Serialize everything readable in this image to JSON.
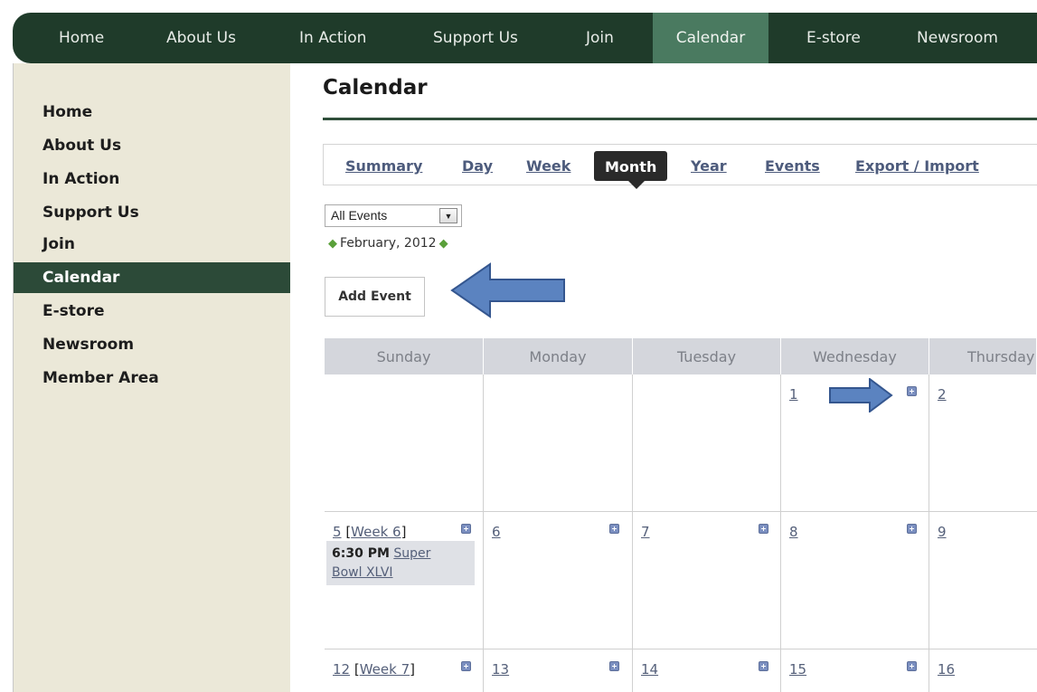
{
  "topnav": {
    "items": [
      {
        "label": "Home"
      },
      {
        "label": "About Us"
      },
      {
        "label": "In Action"
      },
      {
        "label": "Support Us"
      },
      {
        "label": "Join"
      },
      {
        "label": "Calendar",
        "active": true
      },
      {
        "label": "E-store"
      },
      {
        "label": "Newsroom"
      }
    ]
  },
  "sidebar": {
    "items": [
      {
        "label": "Home"
      },
      {
        "label": "About Us"
      },
      {
        "label": "In Action"
      },
      {
        "label": "Support Us"
      },
      {
        "label": "Join"
      },
      {
        "label": "Calendar",
        "active": true
      },
      {
        "label": "E-store"
      },
      {
        "label": "Newsroom"
      },
      {
        "label": "Member Area"
      }
    ]
  },
  "page": {
    "title": "Calendar",
    "tabs": [
      {
        "label": "Summary"
      },
      {
        "label": "Day"
      },
      {
        "label": "Week"
      },
      {
        "label": "Month",
        "active": true
      },
      {
        "label": "Year"
      },
      {
        "label": "Events"
      },
      {
        "label": "Export / Import"
      }
    ],
    "filter": {
      "selected": "All Events"
    },
    "month_label": "February, 2012",
    "add_event_label": "Add Event"
  },
  "calendar": {
    "days": [
      "Sunday",
      "Monday",
      "Tuesday",
      "Wednesday",
      "Thursday"
    ],
    "rows": [
      {
        "cells": [
          {
            "day": ""
          },
          {
            "day": ""
          },
          {
            "day": ""
          },
          {
            "day": "1"
          },
          {
            "day": "2"
          }
        ]
      },
      {
        "week_label": "Week 6",
        "cells": [
          {
            "day": "5",
            "event_time": "6:30 PM",
            "event_title_1": "Super",
            "event_title_2": "Bowl XLVI"
          },
          {
            "day": "6"
          },
          {
            "day": "7"
          },
          {
            "day": "8"
          },
          {
            "day": "9"
          }
        ]
      },
      {
        "week_label": "Week 7",
        "cells": [
          {
            "day": "12"
          },
          {
            "day": "13"
          },
          {
            "day": "14"
          },
          {
            "day": "15"
          },
          {
            "day": "16"
          }
        ]
      }
    ]
  },
  "colors": {
    "nav_bg": "#1f3b2a",
    "nav_active": "#4a7a60",
    "sidebar_bg": "#ebe8d8",
    "sidebar_active": "#2c4a38",
    "annotation_arrow": "#5b83c0"
  }
}
